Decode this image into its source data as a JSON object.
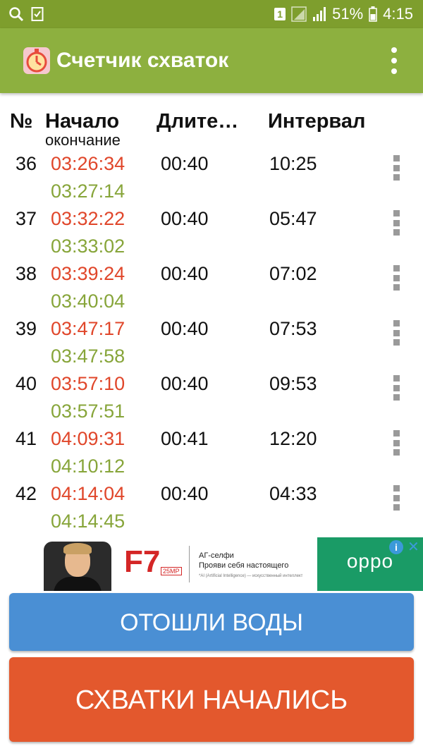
{
  "status_bar": {
    "left_icons": [
      "search-icon",
      "checklist-icon"
    ],
    "sim_badge": "1",
    "battery_percent": "51%",
    "time": "4:15"
  },
  "app_bar": {
    "title": "Счетчик схваток",
    "logo_icon": "stopwatch-logo-icon",
    "menu_icon": "more-vert-icon"
  },
  "table": {
    "headers": {
      "num": "№",
      "start": "Начало",
      "start_sub": "окончание",
      "duration": "Длите…",
      "interval": "Интервал"
    },
    "rows": [
      {
        "num": "36",
        "start": "03:26:34",
        "end": "03:27:14",
        "duration": "00:40",
        "interval": "10:25"
      },
      {
        "num": "37",
        "start": "03:32:22",
        "end": "03:33:02",
        "duration": "00:40",
        "interval": "05:47"
      },
      {
        "num": "38",
        "start": "03:39:24",
        "end": "03:40:04",
        "duration": "00:40",
        "interval": "07:02"
      },
      {
        "num": "39",
        "start": "03:47:17",
        "end": "03:47:58",
        "duration": "00:40",
        "interval": "07:53"
      },
      {
        "num": "40",
        "start": "03:57:10",
        "end": "03:57:51",
        "duration": "00:40",
        "interval": "09:53"
      },
      {
        "num": "41",
        "start": "04:09:31",
        "end": "04:10:12",
        "duration": "00:41",
        "interval": "12:20"
      },
      {
        "num": "42",
        "start": "04:14:04",
        "end": "04:14:45",
        "duration": "00:40",
        "interval": "04:33"
      }
    ]
  },
  "ad": {
    "model": "F7",
    "camera": "25MP",
    "line1": "АГ-селфи",
    "line2": "Прояви себя настоящего",
    "line3": "*AI (Artificial Intelligence) — искусственный интеллект",
    "brand": "oppo"
  },
  "buttons": {
    "water": "ОТОШЛИ ВОДЫ",
    "contractions": "СХВАТКИ НАЧАЛИСЬ"
  },
  "colors": {
    "status_bar": "#7e9e2d",
    "app_bar": "#8db03f",
    "start_time": "#e0462a",
    "end_time": "#87a53a",
    "button_water": "#4a8fd4",
    "button_start": "#e3582d"
  }
}
